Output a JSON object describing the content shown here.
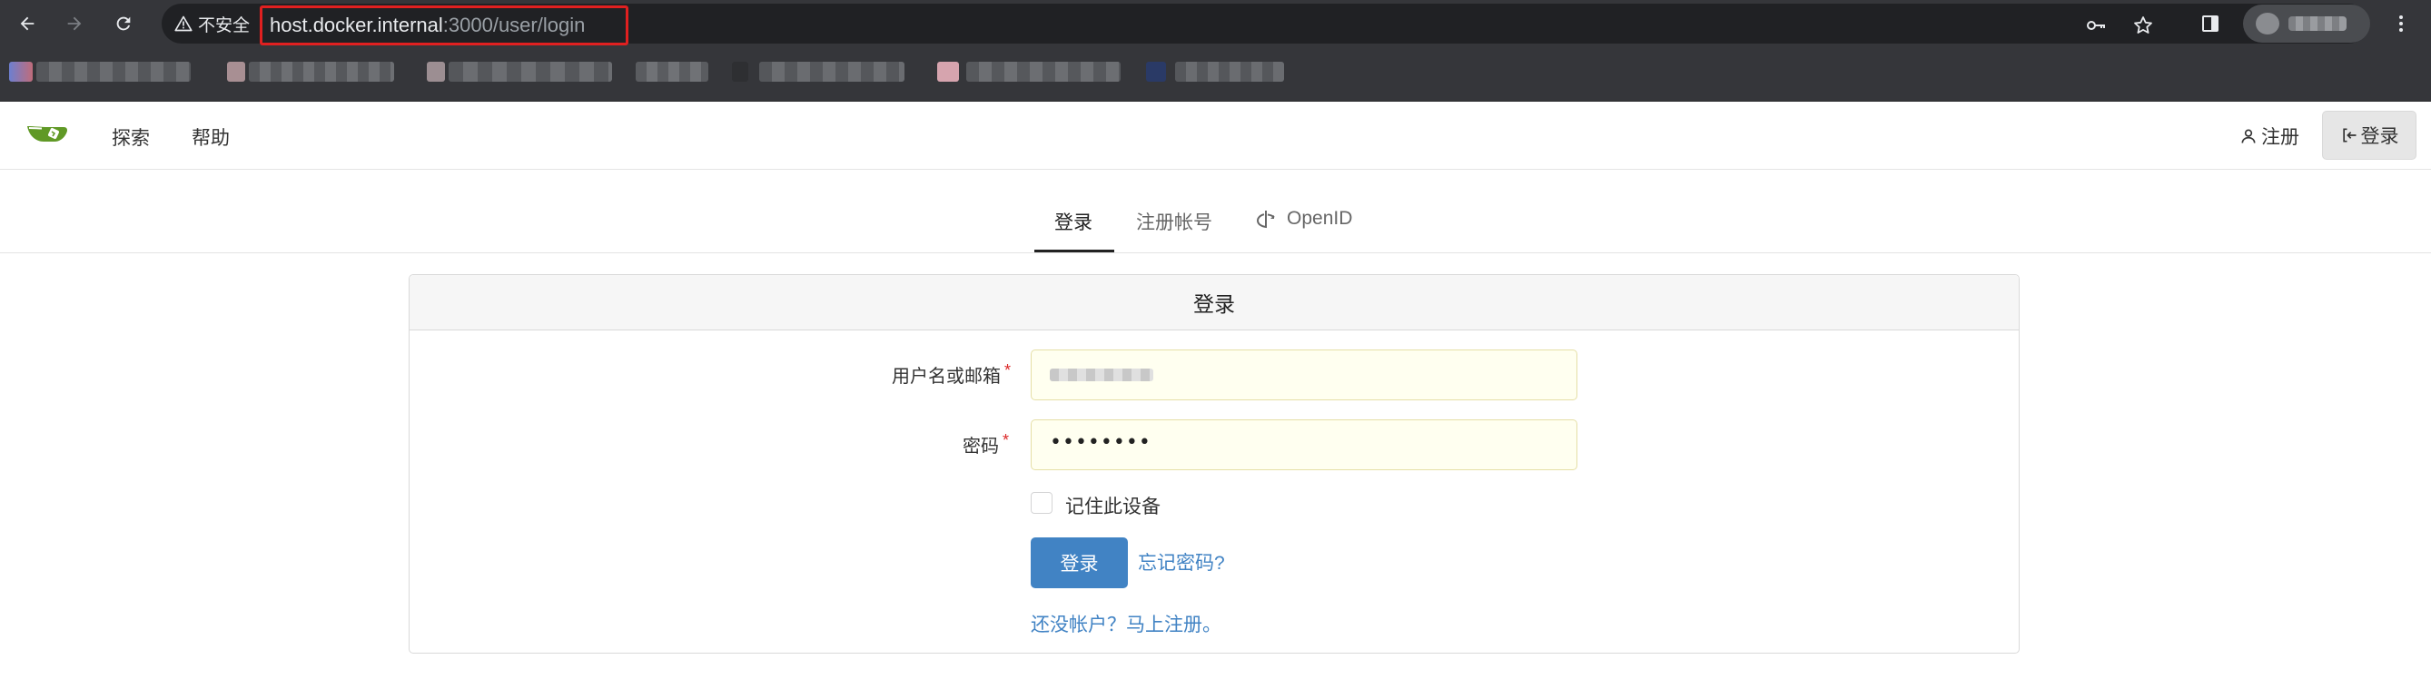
{
  "browser": {
    "security_label": "不安全",
    "url_host": "host.docker.internal",
    "url_path": ":3000/user/login"
  },
  "header": {
    "nav": [
      "探索",
      "帮助"
    ],
    "register_label": "注册",
    "signin_label": "登录"
  },
  "tabs": {
    "login": "登录",
    "register": "注册帐号",
    "openid": "OpenID"
  },
  "form": {
    "title": "登录",
    "username_label": "用户名或邮箱",
    "password_label": "密码",
    "password_value": "••••••••",
    "remember_label": "记住此设备",
    "submit_label": "登录",
    "forgot_link": "忘记密码?",
    "signup_link": "还没帐户？马上注册。"
  },
  "colors": {
    "chrome_bg": "#35363a",
    "omnibox_bg": "#202124",
    "highlight_red": "#e02020",
    "primary_blue": "#4183c4",
    "autofill_bg": "#fffff0",
    "gitea_green": "#609926"
  }
}
